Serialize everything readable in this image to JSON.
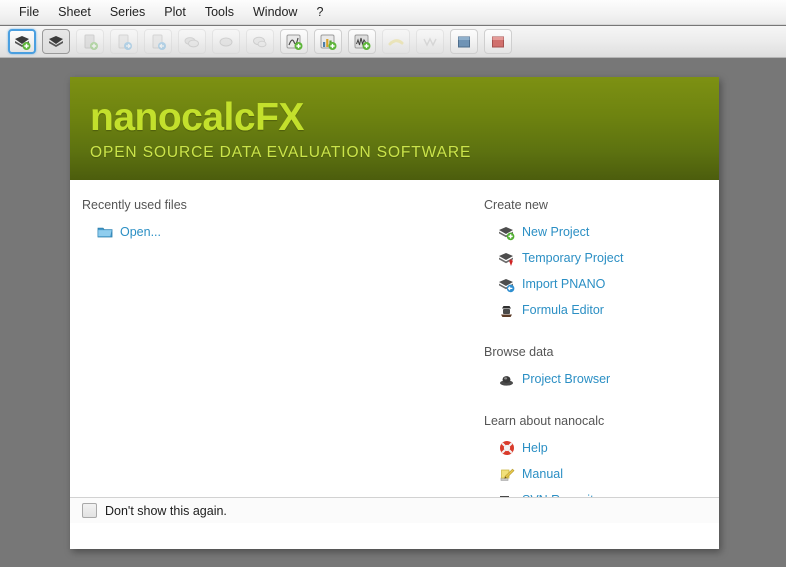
{
  "menubar": {
    "items": [
      {
        "label": "File",
        "name": "menu-file"
      },
      {
        "label": "Sheet",
        "name": "menu-sheet"
      },
      {
        "label": "Series",
        "name": "menu-series"
      },
      {
        "label": "Plot",
        "name": "menu-plot"
      },
      {
        "label": "Tools",
        "name": "menu-tools"
      },
      {
        "label": "Window",
        "name": "menu-window"
      },
      {
        "label": "?",
        "name": "menu-help"
      }
    ]
  },
  "toolbar": {
    "buttons": [
      {
        "icon": "new-project-icon",
        "state": "selected"
      },
      {
        "icon": "open-project-icon",
        "state": "pressed"
      },
      {
        "icon": "new-sheet-icon",
        "state": "disabled"
      },
      {
        "icon": "import-sheet-icon",
        "state": "disabled"
      },
      {
        "icon": "export-sheet-icon",
        "state": "disabled"
      },
      {
        "icon": "multi-series-icon",
        "state": "disabled"
      },
      {
        "icon": "series-icon",
        "state": "disabled"
      },
      {
        "icon": "series-copy-icon",
        "state": "disabled"
      },
      {
        "icon": "add-function-icon",
        "state": "normal"
      },
      {
        "icon": "add-bar-chart-icon",
        "state": "normal"
      },
      {
        "icon": "add-line-chart-icon",
        "state": "normal"
      },
      {
        "icon": "highlight-icon",
        "state": "disabled"
      },
      {
        "icon": "fit-curve-icon",
        "state": "disabled"
      },
      {
        "icon": "blue-cube-icon",
        "state": "normal"
      },
      {
        "icon": "red-cube-icon",
        "state": "normal"
      }
    ]
  },
  "dialog": {
    "banner": {
      "title": "nanocalcFX",
      "subtitle": "OPEN SOURCE DATA EVALUATION SOFTWARE"
    },
    "sections": {
      "recent": {
        "heading": "Recently used files",
        "links": [
          {
            "label": "Open...",
            "icon": "folder-icon",
            "name": "link-open"
          }
        ]
      },
      "create_new": {
        "heading": "Create new",
        "links": [
          {
            "label": "New Project",
            "icon": "new-project-icon",
            "name": "link-new-project"
          },
          {
            "label": "Temporary Project",
            "icon": "temporary-project-icon",
            "name": "link-temporary-project"
          },
          {
            "label": "Import PNANO",
            "icon": "import-pnano-icon",
            "name": "link-import-pnano"
          },
          {
            "label": "Formula Editor",
            "icon": "formula-editor-icon",
            "name": "link-formula-editor"
          }
        ]
      },
      "browse_data": {
        "heading": "Browse data",
        "links": [
          {
            "label": "Project Browser",
            "icon": "project-browser-icon",
            "name": "link-project-browser"
          }
        ]
      },
      "learn": {
        "heading": "Learn about nanocalc",
        "links": [
          {
            "label": "Help",
            "icon": "lifebuoy-icon",
            "name": "link-help"
          },
          {
            "label": "Manual",
            "icon": "manual-icon",
            "name": "link-manual"
          },
          {
            "label": "SVN Repository",
            "icon": "svn-repository-icon",
            "name": "link-svn-repository"
          }
        ]
      }
    },
    "footer": {
      "checkbox_label": "Don't show this again.",
      "checked": false
    }
  },
  "colors": {
    "banner_top": "#7d9113",
    "banner_bottom": "#4c5d0d",
    "title_green": "#c3e02c",
    "link_blue": "#2b8fc4",
    "desktop_gray": "#777777"
  }
}
